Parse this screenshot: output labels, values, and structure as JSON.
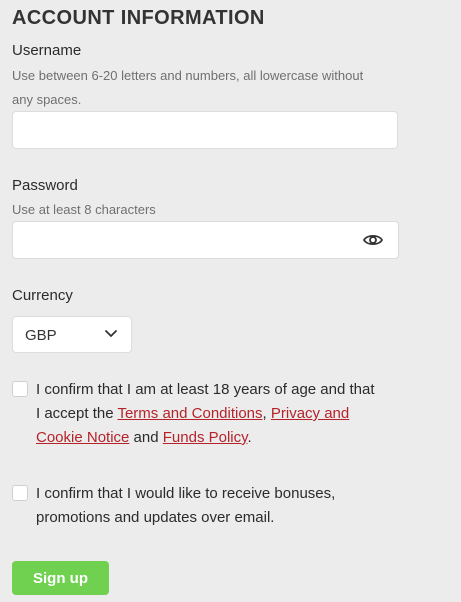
{
  "title": "ACCOUNT INFORMATION",
  "username": {
    "label": "Username",
    "hint_line1": "Use between 6-20 letters and numbers, all lowercase without",
    "hint_line2": "any spaces.",
    "value": ""
  },
  "password": {
    "label": "Password",
    "hint": "Use at least 8 characters",
    "value": "",
    "toggle_icon": "eye-icon"
  },
  "currency": {
    "label": "Currency",
    "selected": "GBP",
    "icon": "chevron-down-icon"
  },
  "age_consent": {
    "text_1": "I confirm that I am at least 18 years of age and that",
    "text_2": "I accept the ",
    "terms_link": "Terms and Conditions",
    "comma": ", ",
    "privacy_link_1": "Privacy and",
    "privacy_link_2": "Cookie Notice",
    "and": " and ",
    "funds_link": "Funds Policy",
    "period": "."
  },
  "marketing_consent": {
    "text_1": "I confirm that I would like to receive bonuses,",
    "text_2": "promotions and updates over email."
  },
  "submit": {
    "label": "Sign up"
  },
  "colors": {
    "background": "#ececec",
    "link": "#b4232a",
    "button": "#6fd14f"
  }
}
